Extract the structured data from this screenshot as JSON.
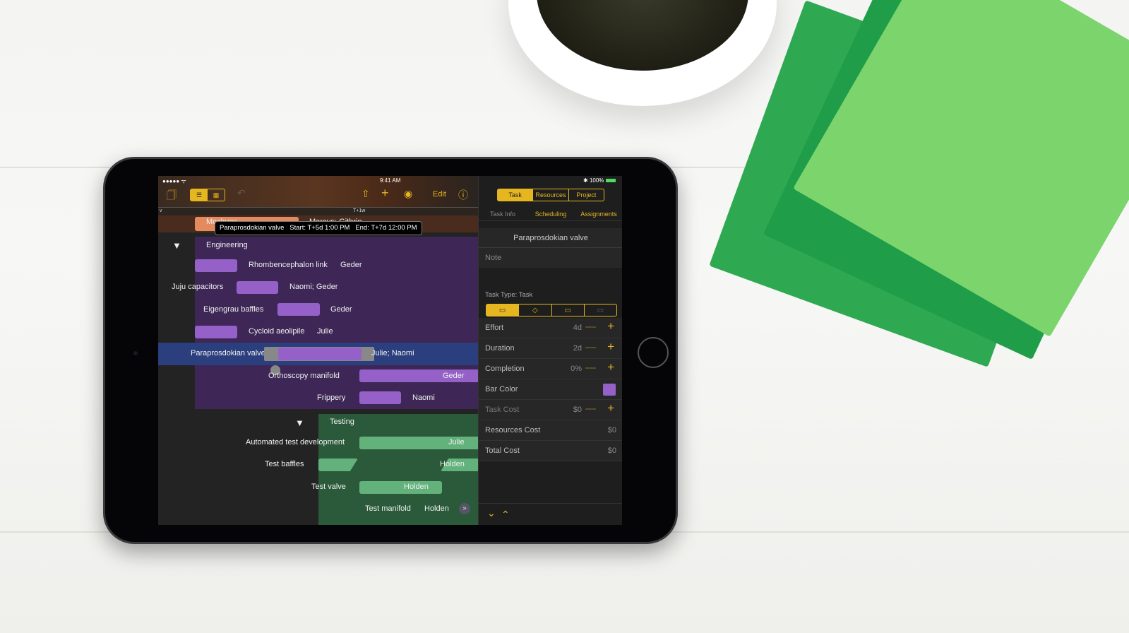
{
  "status": {
    "signal": "●●●●● ᯤ",
    "time": "9:41 AM",
    "battery": "100%",
    "bluetooth": "✱"
  },
  "toolbar": {
    "edit": "Edit",
    "docs_icon": "🗍",
    "undo_icon": "↶",
    "share_icon": "⇧",
    "add_icon": "+",
    "eye_icon": "◉",
    "info_icon": "ⓘ"
  },
  "timeline": {
    "marker": "T+1w",
    "left_marker": "v"
  },
  "top_rows": {
    "mockups": "Mockups",
    "marcus": "Marcus; Githrin"
  },
  "tooltip": {
    "task": "Paraprosdokian valve",
    "start": "Start: T+5d 1:00 PM",
    "end": "End: T+7d 12:00 PM"
  },
  "groups": {
    "engineering": "Engineering",
    "testing": "Testing"
  },
  "tasks": [
    {
      "name": "Rhombencephalon link",
      "resource": "Geder"
    },
    {
      "name": "Juju capacitors",
      "resource": "Naomi; Geder"
    },
    {
      "name": "Eigengrau baffles",
      "resource": "Geder"
    },
    {
      "name": "Cycloid aeolipile",
      "resource": "Julie"
    },
    {
      "name": "Paraprosdokian valve",
      "resource": "Julie; Naomi"
    },
    {
      "name": "Orthoscopy manifold",
      "resource": "Geder"
    },
    {
      "name": "Frippery",
      "resource": "Naomi"
    },
    {
      "name": "Automated test development",
      "resource": "Julie"
    },
    {
      "name": "Test baffles",
      "resource": "Holden"
    },
    {
      "name": "Test valve",
      "resource": "Holden"
    },
    {
      "name": "Test manifold",
      "resource": "Holden"
    }
  ],
  "inspector": {
    "tabs": [
      "Task",
      "Resources",
      "Project"
    ],
    "subtabs": [
      "Task Info",
      "Scheduling",
      "Assignments"
    ],
    "title": "Paraprosdokian valve",
    "note_placeholder": "Note",
    "task_type": "Task Type: Task",
    "fields": [
      {
        "label": "Effort",
        "value": "4d"
      },
      {
        "label": "Duration",
        "value": "2d"
      },
      {
        "label": "Completion",
        "value": "0%"
      },
      {
        "label": "Bar Color",
        "value": ""
      },
      {
        "label": "Task Cost",
        "value": "$0"
      },
      {
        "label": "Resources Cost",
        "value": "$0"
      },
      {
        "label": "Total Cost",
        "value": "$0"
      }
    ],
    "bar_color": "#9561c9"
  }
}
